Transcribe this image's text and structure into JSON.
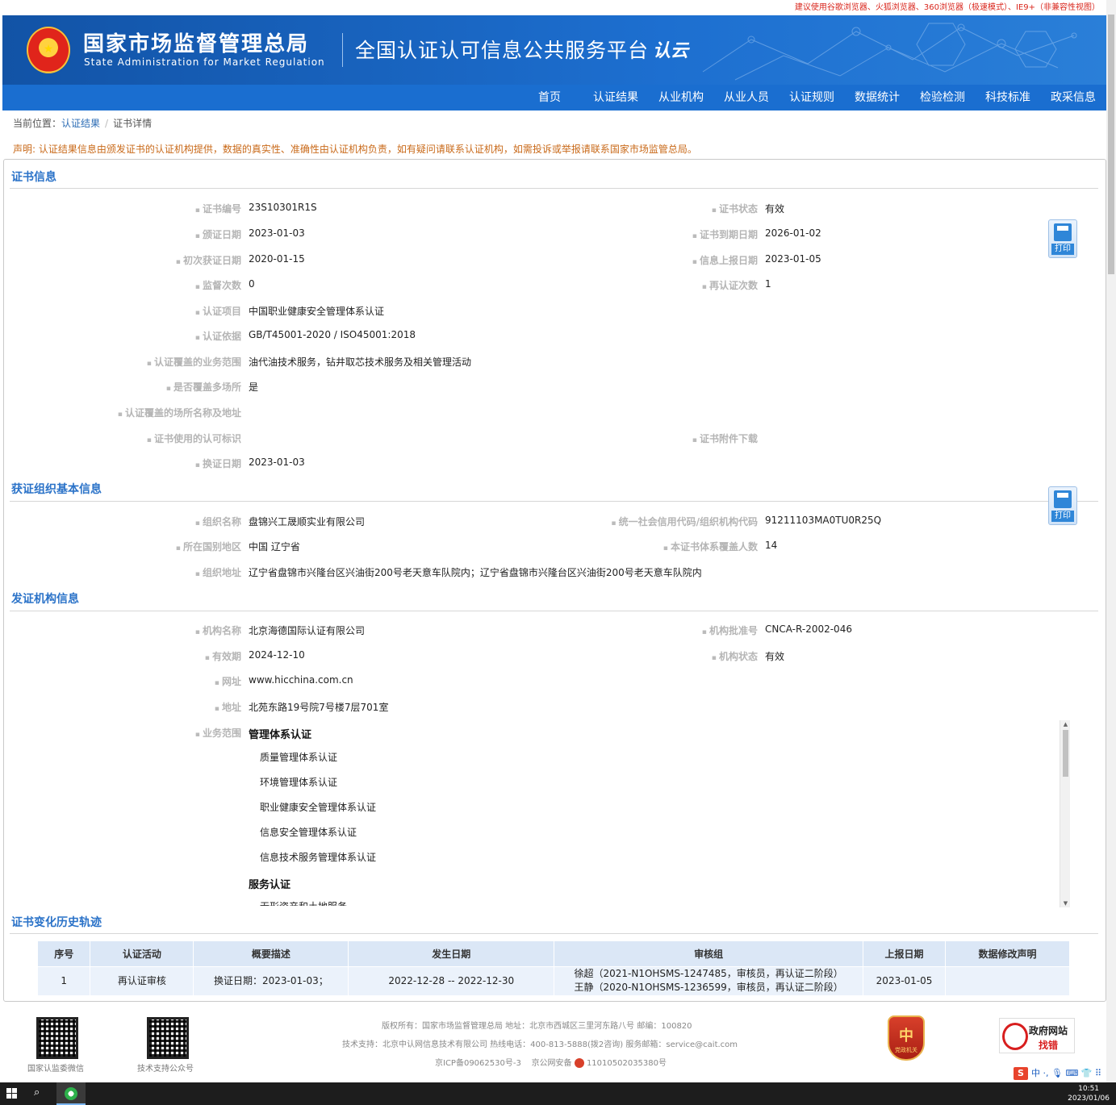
{
  "top_notice": "建议使用谷歌浏览器、火狐浏览器、360浏览器（极速模式）、IE9+（非兼容性视图）",
  "header": {
    "org_cn": "国家市场监督管理总局",
    "org_en": "State Administration  for  Market Regulation",
    "platform": "全国认证认可信息公共服务平台",
    "logo_text": "认云"
  },
  "nav": [
    "首页",
    "认证结果",
    "从业机构",
    "从业人员",
    "认证规则",
    "数据统计",
    "检验检测",
    "科技标准",
    "政采信息"
  ],
  "breadcrumb": {
    "prefix": "当前位置：",
    "link": "认证结果",
    "current": "证书详情"
  },
  "statement": "声明: 认证结果信息由颁发证书的认证机构提供，数据的真实性、准确性由认证机构负责，如有疑问请联系认证机构，如需投诉或举报请联系国家市场监管总局。",
  "cert": {
    "title": "证书信息",
    "left": [
      {
        "label": "证书编号",
        "value": "23S10301R1S"
      },
      {
        "label": "颁证日期",
        "value": "2023-01-03"
      },
      {
        "label": "初次获证日期",
        "value": "2020-01-15"
      },
      {
        "label": "监督次数",
        "value": "0"
      },
      {
        "label": "认证项目",
        "value": "中国职业健康安全管理体系认证"
      },
      {
        "label": "认证依据",
        "value": "GB/T45001-2020 / ISO45001:2018"
      },
      {
        "label": "认证覆盖的业务范围",
        "value": "油代油技术服务，钻井取芯技术服务及相关管理活动"
      },
      {
        "label": "是否覆盖多场所",
        "value": "是"
      },
      {
        "label": "认证覆盖的场所名称及地址",
        "value": ""
      },
      {
        "label": "证书使用的认可标识",
        "value": ""
      },
      {
        "label": "换证日期",
        "value": "2023-01-03"
      }
    ],
    "right": [
      {
        "label": "证书状态",
        "value": "有效"
      },
      {
        "label": "证书到期日期",
        "value": "2026-01-02"
      },
      {
        "label": "信息上报日期",
        "value": "2023-01-05"
      },
      {
        "label": "再认证次数",
        "value": "1"
      },
      {
        "label": "证书附件下载",
        "value": ""
      }
    ],
    "print_label": "打印"
  },
  "org": {
    "title": "获证组织基本信息",
    "rows": [
      {
        "l_label": "组织名称",
        "l_value": "盘锦兴工晟顺实业有限公司",
        "r_label": "统一社会信用代码/组织机构代码",
        "r_value": "91211103MA0TU0R25Q"
      },
      {
        "l_label": "所在国别地区",
        "l_value": "中国 辽宁省",
        "r_label": "本证书体系覆盖人数",
        "r_value": "14"
      }
    ],
    "address_label": "组织地址",
    "address": "辽宁省盘锦市兴隆台区兴油街200号老天意车队院内；辽宁省盘锦市兴隆台区兴油街200号老天意车队院内",
    "print_label": "打印"
  },
  "issuer": {
    "title": "发证机构信息",
    "name_label": "机构名称",
    "name": "北京海德国际认证有限公司",
    "approval_label": "机构批准号",
    "approval": "CNCA-R-2002-046",
    "valid_label": "有效期",
    "valid": "2024-12-10",
    "status_label": "机构状态",
    "status": "有效",
    "web_label": "网址",
    "web": "www.hicchina.com.cn",
    "addr_label": "地址",
    "addr": "北苑东路19号院7号楼7层701室",
    "scope_label": "业务范围",
    "scope": [
      {
        "head": "管理体系认证",
        "items": [
          "质量管理体系认证",
          "环境管理体系认证",
          "职业健康安全管理体系认证",
          "信息安全管理体系认证",
          "信息技术服务管理体系认证"
        ]
      },
      {
        "head": "服务认证",
        "items": [
          "无形资产和土地服务"
        ]
      }
    ]
  },
  "history": {
    "title": "证书变化历史轨迹",
    "columns": [
      "序号",
      "认证活动",
      "概要描述",
      "发生日期",
      "审核组",
      "上报日期",
      "数据修改声明"
    ],
    "rows": [
      {
        "no": "1",
        "activity": "再认证审核",
        "summary": "换证日期：2023-01-03；",
        "date": "2022-12-28 -- 2022-12-30",
        "team1": "徐超（2021-N1OHSMS-1247485，审核员，再认证二阶段）",
        "team2": "王静（2020-N1OHSMS-1236599，审核员，再认证二阶段）",
        "report": "2023-01-05",
        "mod": ""
      }
    ]
  },
  "footer": {
    "qr1": "国家认监委微信",
    "qr2": "技术支持公众号",
    "line1": "版权所有：国家市场监督管理总局    地址：北京市西城区三里河东路八号    邮编：100820",
    "line2": "技术支持：北京中认网信息技术有限公司    热线电话：400-813-5888(拨2咨询)    服务邮箱：service@cait.com",
    "line3a": "京ICP备09062530号-3",
    "line3b": "京公网安备",
    "line3c": "11010502035380号",
    "badge1": "党政机关",
    "badge2a": "政府网站",
    "badge2b": "找错",
    "ime": "中 ·, 🎙 ⌨ 👕 ⠿"
  },
  "taskbar": {
    "time": "10:51",
    "date": "2023/01/06"
  }
}
